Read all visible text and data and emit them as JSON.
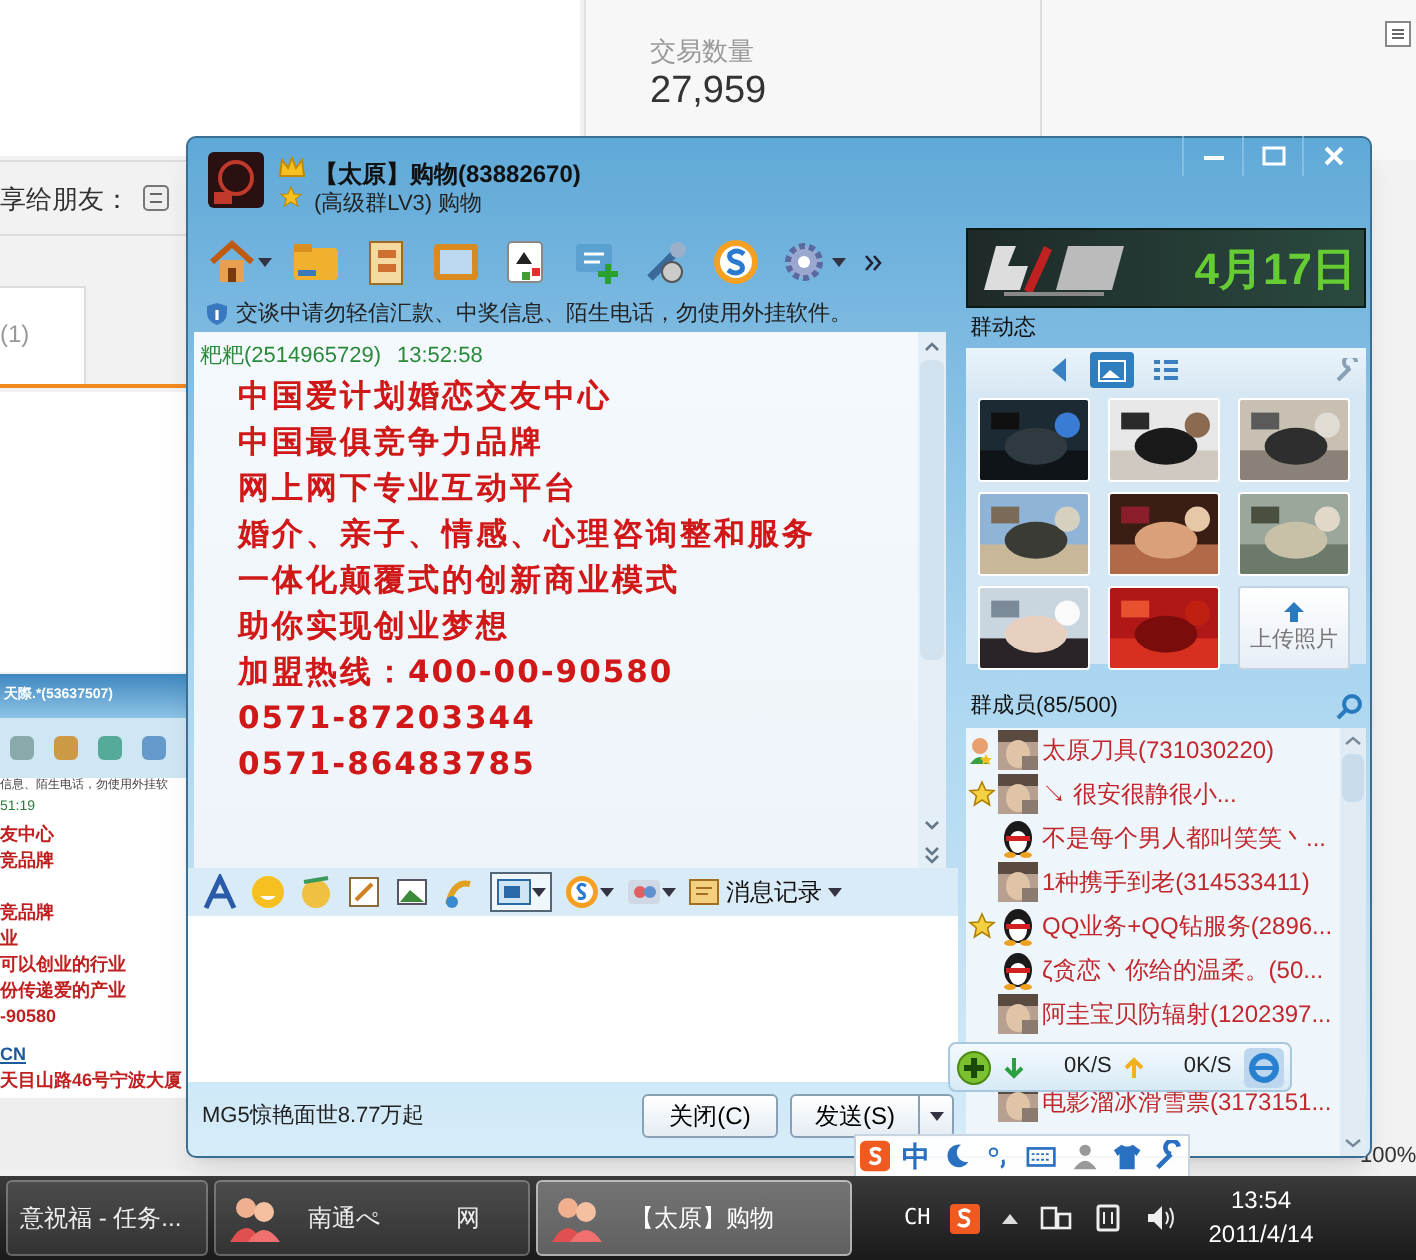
{
  "background_page": {
    "stat_label": "交易数量",
    "stat_value": "27,959",
    "share_label": "享给朋友：",
    "tab_count": "(1)",
    "zoom": "100%"
  },
  "background_chat": {
    "title": "天際.*(53637507)",
    "notice": "信息、陌生电话，勿使用外挂软",
    "time": "51:19",
    "lines": [
      "友中心",
      "竞品牌",
      "竞品牌",
      "业",
      "可以创业的行业",
      "份传递爱的产业",
      "-90580",
      "CN",
      "天目山路46号宁波大厦"
    ]
  },
  "chat_window": {
    "title": "【太原】购物(83882670)",
    "subtitle": "(高级群LV3) 购物",
    "notice": "交谈中请勿轻信汇款、中奖信息、陌生电话，勿使用外挂软件。",
    "message": {
      "sender": "粑粑(2514965729)",
      "time": "13:52:58",
      "lines": [
        "中国爱计划婚恋交友中心",
        "中国最俱竞争力品牌",
        "网上网下专业互动平台",
        "婚介、亲子、情感、心理咨询整和服务",
        "一体化颠覆式的创新商业模式",
        "助你实现创业梦想",
        "加盟热线：400-00-90580",
        "0571-87203344",
        "0571-86483785"
      ]
    },
    "history_button": "消息记录",
    "footer_ad": "MG5惊艳面世8.77万起",
    "close_button": "关闭(C)",
    "send_button": "发送(S)"
  },
  "side_panel": {
    "banner_date": "4月17日",
    "feed_title": "群动态",
    "upload_label": "上传照片",
    "members_title": "群成员(85/500)",
    "members": [
      {
        "name": "太原刀具(731030220)",
        "kind": "owner",
        "penguin_avatar": false
      },
      {
        "name": "↘ 很安很静很小...",
        "kind": "admin",
        "penguin_avatar": false
      },
      {
        "name": "不是每个男人都叫笑笑丶...",
        "kind": "member",
        "penguin_avatar": true
      },
      {
        "name": "1种携手到老(314533411)",
        "kind": "member",
        "penguin_avatar": false
      },
      {
        "name": "QQ业务+QQ钻服务(2896...",
        "kind": "admin",
        "penguin_avatar": true
      },
      {
        "name": "ζ贪恋丶你给的温柔。(50...",
        "kind": "member",
        "penguin_avatar": true
      },
      {
        "name": "阿圭宝贝防辐射(1202397...",
        "kind": "member",
        "penguin_avatar": false
      },
      {
        "name": "电影溜冰滑雪票(3173151...",
        "kind": "member",
        "penguin_avatar": false
      }
    ]
  },
  "speed_widget": {
    "download": "0K/S",
    "upload": "0K/S"
  },
  "ime_bar": {
    "mode": "中"
  },
  "taskbar": {
    "tasks": [
      {
        "label": "意祝福 - 任务...",
        "selected": false
      },
      {
        "label": "南通ぺ",
        "extra": "网",
        "selected": false
      },
      {
        "label": "【太原】购物",
        "selected": true
      }
    ],
    "language": "CH",
    "time": "13:54",
    "date": "2011/4/14"
  }
}
